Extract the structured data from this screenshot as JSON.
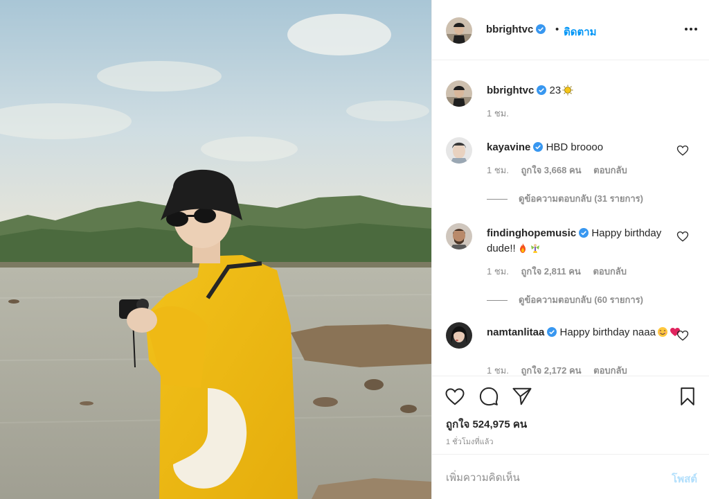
{
  "post": {
    "author": "bbrightvc",
    "follow_label": "ติดตาม",
    "separator": "•",
    "caption_text": "23",
    "caption_time": "1 ชม."
  },
  "comments": [
    {
      "user": "kayavine",
      "text": "HBD broooo",
      "time": "1 ชม.",
      "likes": "ถูกใจ 3,668 คน",
      "reply": "ตอบกลับ",
      "view_replies": "ดูข้อความตอบกลับ (31 รายการ)"
    },
    {
      "user": "findinghopemusic",
      "text": "Happy birthday dude!!",
      "time": "1 ชม.",
      "likes": "ถูกใจ 2,811 คน",
      "reply": "ตอบกลับ",
      "view_replies": "ดูข้อความตอบกลับ (60 รายการ)"
    },
    {
      "user": "namtanlitaa",
      "text": "Happy birthday naaa",
      "time": "1 ชม.",
      "likes": "ถูกใจ 2,172 คน",
      "reply": "ตอบกลับ"
    }
  ],
  "actions": {
    "likes_label": "ถูกใจ 524,975 คน",
    "time_ago": "1 ชั่วโมงที่แล้ว"
  },
  "add_comment": {
    "placeholder": "เพิ่มความคิดเห็น",
    "post_label": "โพสต์"
  },
  "icons": {
    "verified": "verified-badge-icon",
    "more": "more-options-icon",
    "like": "heart-icon",
    "comment": "comment-bubble-icon",
    "share": "paper-plane-icon",
    "save": "bookmark-icon"
  },
  "colors": {
    "link_blue": "#0095f6",
    "verified_blue": "#3897f0",
    "muted_text": "#8e8e8e",
    "post_disabled": "#b2dffc"
  }
}
